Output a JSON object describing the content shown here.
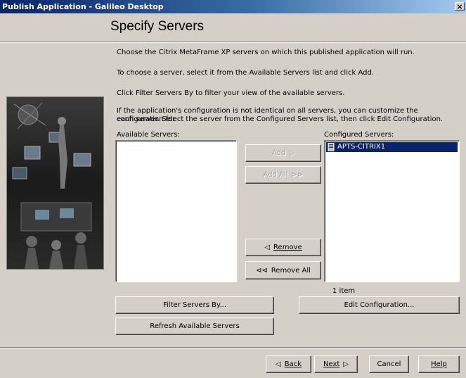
{
  "window": {
    "title": "Publish Application - Galileo Desktop",
    "close_glyph": "×"
  },
  "header": {
    "title": "Specify Servers"
  },
  "instructions": {
    "line1": "Choose the Citrix MetaFrame XP servers on which this published application will run.",
    "line2": "To choose a server, select it from the Available Servers list and click Add.",
    "line3": "Click Filter Servers By to filter your view of the available servers.",
    "line4a": "If the application's configuration is not identical on all servers, you can customize the configuration for",
    "line4b": "each server.  Select the server from the Configured Servers list, then click Edit Configuration."
  },
  "available": {
    "label": "Available Servers:",
    "items": []
  },
  "configured": {
    "label": "Configured Servers:",
    "items": [
      {
        "name": "APTS-CITRIX1",
        "icon": "server-icon",
        "selected": true
      }
    ],
    "count": "1 item"
  },
  "transfer_buttons": {
    "add": "Add",
    "add_all": "Add All",
    "remove": "Remove",
    "remove_all": "Remove All"
  },
  "action_buttons": {
    "filter": "Filter Servers By...",
    "refresh": "Refresh Available Servers",
    "edit": "Edit Configuration..."
  },
  "nav_buttons": {
    "back": "Back",
    "next": "Next",
    "cancel": "Cancel",
    "help": "Help"
  },
  "colors": {
    "title_bar": "#0a246a",
    "selection": "#0a246a",
    "face": "#d4d0c8"
  }
}
